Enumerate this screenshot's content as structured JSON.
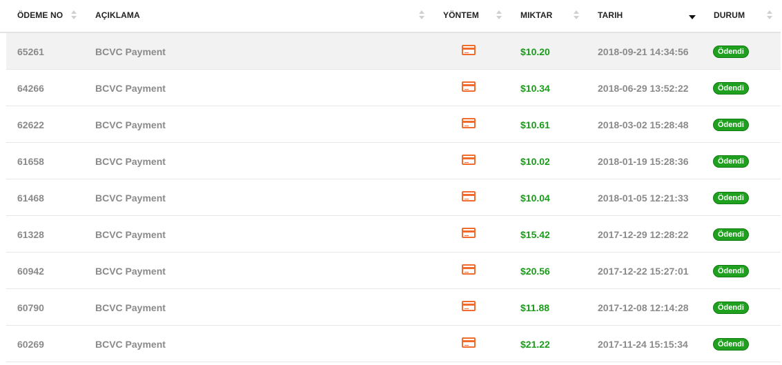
{
  "columns": {
    "payment_no": "ÖDEME NO",
    "description": "AÇIKLAMA",
    "method": "YÖNTEM",
    "amount": "MIKTAR",
    "date": "TARIH",
    "status": "DURUM"
  },
  "icons": {
    "method": "credit-card-icon",
    "sort": "sort-icon",
    "sort_active": "sort-descending-icon"
  },
  "colors": {
    "amount": "#1a9b1a",
    "badge": "#1fa11f",
    "card_icon": "#f06b2c"
  },
  "rows": [
    {
      "id": "65261",
      "description": "BCVC Payment",
      "amount": "$10.20",
      "date": "2018-09-21 14:34:56",
      "status": "Ödendi"
    },
    {
      "id": "64266",
      "description": "BCVC Payment",
      "amount": "$10.34",
      "date": "2018-06-29 13:52:22",
      "status": "Ödendi"
    },
    {
      "id": "62622",
      "description": "BCVC Payment",
      "amount": "$10.61",
      "date": "2018-03-02 15:28:48",
      "status": "Ödendi"
    },
    {
      "id": "61658",
      "description": "BCVC Payment",
      "amount": "$10.02",
      "date": "2018-01-19 15:28:36",
      "status": "Ödendi"
    },
    {
      "id": "61468",
      "description": "BCVC Payment",
      "amount": "$10.04",
      "date": "2018-01-05 12:21:33",
      "status": "Ödendi"
    },
    {
      "id": "61328",
      "description": "BCVC Payment",
      "amount": "$15.42",
      "date": "2017-12-29 12:28:22",
      "status": "Ödendi"
    },
    {
      "id": "60942",
      "description": "BCVC Payment",
      "amount": "$20.56",
      "date": "2017-12-22 15:27:01",
      "status": "Ödendi"
    },
    {
      "id": "60790",
      "description": "BCVC Payment",
      "amount": "$11.88",
      "date": "2017-12-08 12:14:28",
      "status": "Ödendi"
    },
    {
      "id": "60269",
      "description": "BCVC Payment",
      "amount": "$21.22",
      "date": "2017-11-24 15:15:34",
      "status": "Ödendi"
    }
  ]
}
